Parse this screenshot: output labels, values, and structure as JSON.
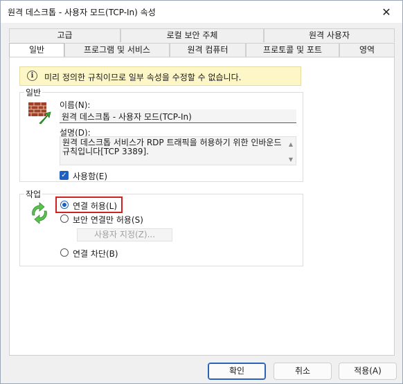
{
  "window": {
    "title": "원격 데스크톱 - 사용자 모드(TCP-In) 속성",
    "close_glyph": "✕"
  },
  "tabs": {
    "row1": [
      "고급",
      "로컬 보안 주체",
      "원격 사용자"
    ],
    "row2": [
      "일반",
      "프로그램 및 서비스",
      "원격 컴퓨터",
      "프로토콜 및 포트",
      "영역"
    ],
    "active": "일반"
  },
  "info": {
    "icon": "info-icon",
    "text": "미리 정의한 규칙이므로 일부 속성을 수정할 수 없습니다."
  },
  "general": {
    "legend": "일반",
    "name_label": "이름(N):",
    "name_value": "원격 데스크톱 - 사용자 모드(TCP-In)",
    "desc_label": "설명(D):",
    "desc_value": "원격 데스크톱 서비스가 RDP 트래픽을 허용하기 위한 인바운드 규칙입니다[TCP 3389].",
    "enabled_label": "사용함(E)",
    "enabled": true
  },
  "action": {
    "legend": "작업",
    "allow_label": "연결 허용(L)",
    "secure_label": "보안 연결만 허용(S)",
    "customize_label": "사용자 지정(Z)...",
    "block_label": "연결 차단(B)",
    "selected": "allow"
  },
  "buttons": {
    "ok": "확인",
    "cancel": "취소",
    "apply": "적용(A)"
  }
}
